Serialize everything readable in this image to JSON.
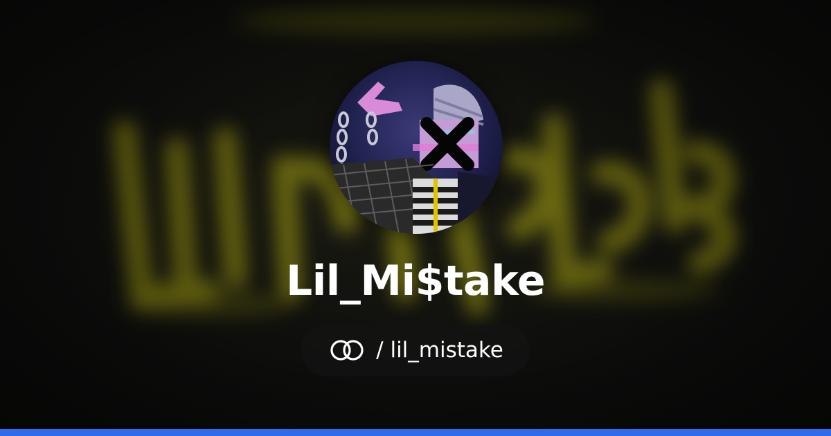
{
  "profile": {
    "display_name": "Lil_Mi$take",
    "handle": "/ lil_mistake",
    "logo_icon": "linked-rings-icon",
    "avatar_alt": "profile-avatar"
  },
  "colors": {
    "background": "#121210",
    "backdrop_graffiti": "#c9c61a",
    "accent_bar": "#2f6bea",
    "text": "#ffffff",
    "pill": "#141414"
  }
}
